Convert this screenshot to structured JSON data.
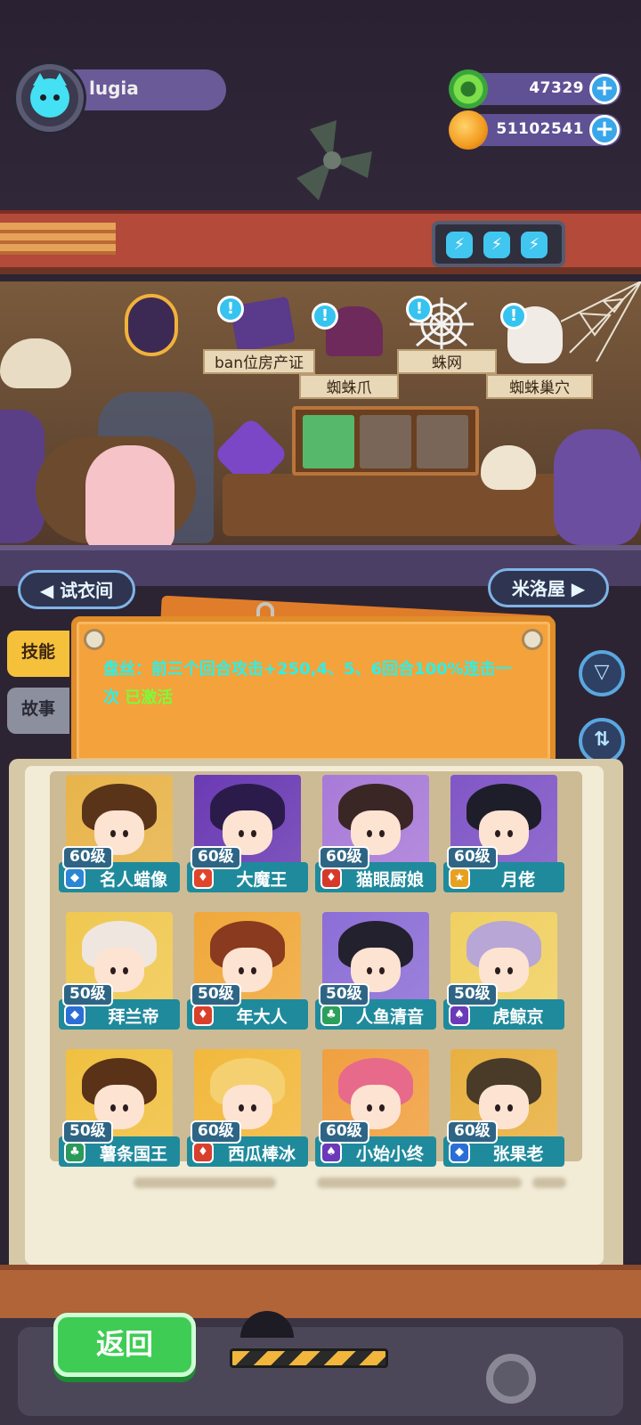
{
  "player": {
    "name": "lugia"
  },
  "currency": [
    {
      "icon": "green-gem-icon",
      "value": "47329",
      "color": "#41c944"
    },
    {
      "icon": "planet-coin-icon",
      "value": "51102541",
      "color": "#f6a523"
    }
  ],
  "energy": [
    "⚡",
    "⚡",
    "⚡"
  ],
  "scene": {
    "tags": [
      "ban位房产证",
      "蜘蛛爪",
      "蛛网",
      "蜘蛛巢穴"
    ],
    "alert_symbol": "!",
    "nav_left": "◀ 试衣间",
    "nav_right": "米洛屋 ▶"
  },
  "tabs": [
    "技能",
    "故事"
  ],
  "skill": {
    "text": "盘丝：前三个回合攻击+250,4、5、6回合100%连击一次",
    "status": "已激活"
  },
  "side_buttons": {
    "filter_symbol": "▽",
    "sort_symbol": "⇅"
  },
  "characters": [
    {
      "name": "名人蜡像",
      "level": "60级",
      "element": "water",
      "elem_color": "#2b86d6",
      "bg": "#e8b44a",
      "hair": "#5a3418"
    },
    {
      "name": "大魔王",
      "level": "60级",
      "element": "fire",
      "elem_color": "#e0452a",
      "bg": "#6a3ab3",
      "hair": "#2b1b4a"
    },
    {
      "name": "猫眼厨娘",
      "level": "60级",
      "element": "fire",
      "elem_color": "#d6392a",
      "bg": "#a87ad8",
      "hair": "#3b2626"
    },
    {
      "name": "月佬",
      "level": "60级",
      "element": "light",
      "elem_color": "#e6a11f",
      "bg": "#8056c6",
      "hair": "#1e1e2a"
    },
    {
      "name": "拜兰帝",
      "level": "50级",
      "element": "wind",
      "elem_color": "#2b6fd6",
      "bg": "#f0c850",
      "hair": "#efe6e0"
    },
    {
      "name": "年大人",
      "level": "50级",
      "element": "fire",
      "elem_color": "#d9402c",
      "bg": "#f0a83a",
      "hair": "#8a3a1e"
    },
    {
      "name": "人鱼清音",
      "level": "50级",
      "element": "nature",
      "elem_color": "#2aa05a",
      "bg": "#8c6ed6",
      "hair": "#23212e"
    },
    {
      "name": "虎鲸京",
      "level": "50级",
      "element": "dark",
      "elem_color": "#6a3ab8",
      "bg": "#f0d060",
      "hair": "#b8a6d6"
    },
    {
      "name": "薯条国王",
      "level": "50级",
      "element": "nature",
      "elem_color": "#2a9a5a",
      "bg": "#f0c040",
      "hair": "#5a3218"
    },
    {
      "name": "西瓜棒冰",
      "level": "60级",
      "element": "fire",
      "elem_color": "#d8402c",
      "bg": "#f2b83c",
      "hair": "#f5d070"
    },
    {
      "name": "小始小终",
      "level": "60级",
      "element": "dark",
      "elem_color": "#6a3ab8",
      "bg": "#f0a040",
      "hair": "#e86a8a"
    },
    {
      "name": "张果老",
      "level": "60级",
      "element": "wind",
      "elem_color": "#2b6fd6",
      "bg": "#e8b040",
      "hair": "#4a3a28"
    }
  ],
  "footer": {
    "back_label": "返回"
  }
}
